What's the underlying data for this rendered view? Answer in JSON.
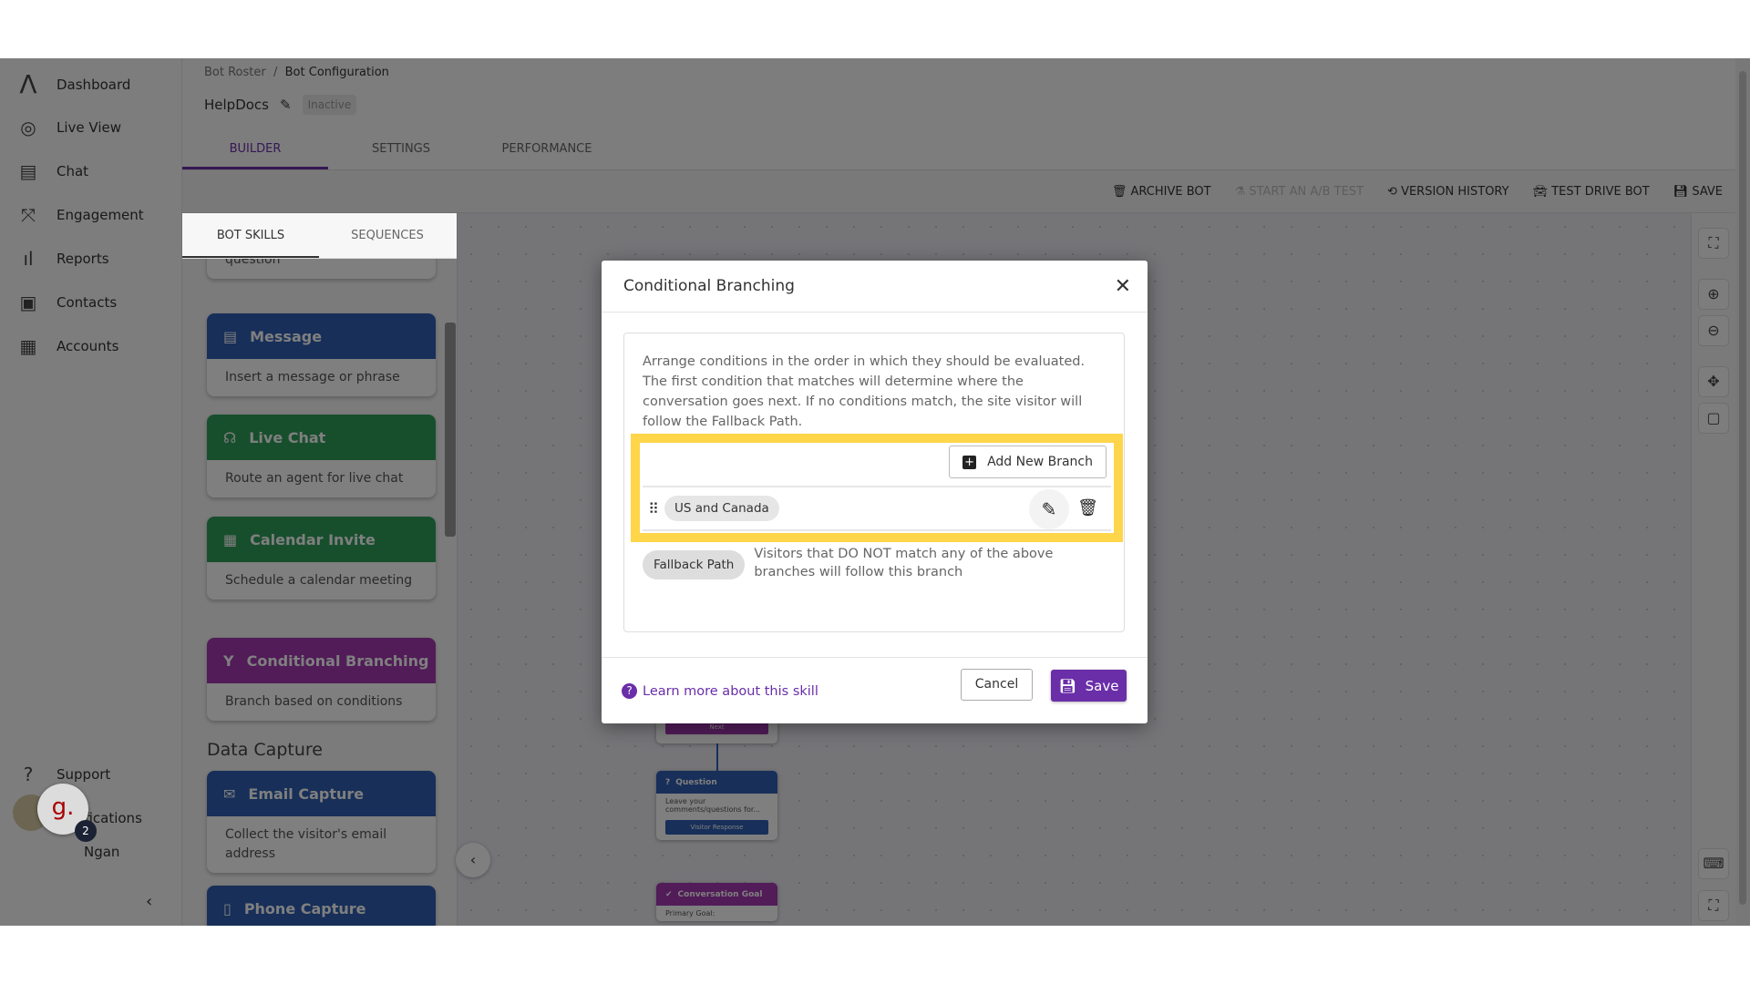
{
  "sidebar": {
    "items": [
      {
        "label": "Dashboard",
        "icon": "logo-icon"
      },
      {
        "label": "Live View",
        "icon": "live-view-icon"
      },
      {
        "label": "Chat",
        "icon": "chat-icon"
      },
      {
        "label": "Engagement",
        "icon": "engagement-icon"
      },
      {
        "label": "Reports",
        "icon": "reports-icon"
      },
      {
        "label": "Contacts",
        "icon": "contacts-icon"
      },
      {
        "label": "Accounts",
        "icon": "accounts-icon"
      }
    ],
    "bottom": [
      {
        "label": "Support",
        "icon": "help-icon"
      },
      {
        "label": "Notifications",
        "icon": "bell-icon"
      }
    ],
    "user": {
      "name": "Ngan",
      "notification_count": "2",
      "widget_letter": "g."
    }
  },
  "breadcrumb": [
    "Bot Roster",
    "Bot Configuration"
  ],
  "bot": {
    "name": "HelpDocs",
    "status": "Inactive"
  },
  "tabs": [
    "BUILDER",
    "SETTINGS",
    "PERFORMANCE"
  ],
  "toolbar": {
    "archive": "ARCHIVE BOT",
    "ab_test": "START AN A/B TEST",
    "version_history": "VERSION HISTORY",
    "test_drive": "TEST DRIVE BOT",
    "save": "SAVE"
  },
  "panel": {
    "tabs": [
      "BOT SKILLS",
      "SEQUENCES"
    ],
    "cards": [
      {
        "title": "",
        "desc": "Ask your site visitors a simple question"
      },
      {
        "title": "Message",
        "desc": "Insert a message or phrase",
        "color": "#2f5fb3"
      },
      {
        "title": "Live Chat",
        "desc": "Route an agent for live chat",
        "color": "#2e9e5b"
      },
      {
        "title": "Calendar Invite",
        "desc": "Schedule a calendar meeting",
        "color": "#2e9e5b"
      },
      {
        "title": "Conditional Branching",
        "desc": "Branch based on conditions",
        "color": "#a238b0"
      }
    ],
    "section": "Data Capture",
    "capture_cards": [
      {
        "title": "Email Capture",
        "desc": "Collect the visitor's email address",
        "color": "#2f5fb3"
      },
      {
        "title": "Phone Capture",
        "desc": "",
        "color": "#2f5fb3"
      }
    ]
  },
  "canvas": {
    "nodes": [
      {
        "button": "Next"
      },
      {
        "title": "Question",
        "body": "Leave your comments/questions for...",
        "button": "Visitor Response"
      },
      {
        "title": "Conversation Goal",
        "body": "Primary Goal:"
      }
    ]
  },
  "modal": {
    "title": "Conditional Branching",
    "description": "Arrange conditions in the order in which they should be evaluated. The first condition that matches will determine where the conversation goes next. If no conditions match, the site visitor will follow the Fallback Path.",
    "add_branch": "Add New Branch",
    "branches": [
      {
        "name": "US and Canada"
      }
    ],
    "fallback": {
      "label": "Fallback Path",
      "text": "Visitors that DO NOT match any of the above branches will follow this branch"
    },
    "learn_more": "Learn more about this skill",
    "cancel": "Cancel",
    "save": "Save"
  },
  "colors": {
    "accent": "#6a2ea8",
    "highlight": "#ffd54a"
  }
}
